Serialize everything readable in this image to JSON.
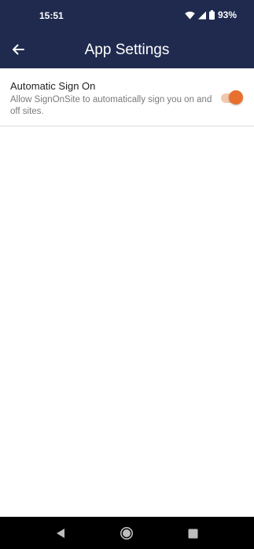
{
  "status_bar": {
    "time": "15:51",
    "battery": "93%",
    "icons": [
      "wifi-icon",
      "signal-icon",
      "battery-icon"
    ]
  },
  "app_bar": {
    "title": "App Settings",
    "back_icon": "arrow-left-icon",
    "background": "#1f2a4e"
  },
  "settings": [
    {
      "title": "Automatic Sign On",
      "description": "Allow SignOnSite to automatically sign you on and off sites.",
      "enabled": true,
      "accent": "#e8702e"
    }
  ],
  "nav_bar": {
    "icons": [
      "nav-back-icon",
      "nav-home-icon",
      "nav-recents-icon"
    ]
  }
}
